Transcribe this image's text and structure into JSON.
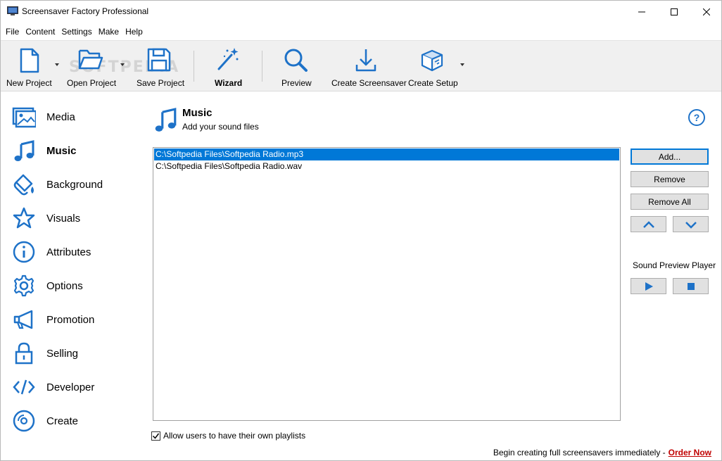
{
  "window": {
    "title": "Screensaver Factory Professional",
    "controls": {
      "minimize": "minimize-icon",
      "maximize": "maximize-icon",
      "close": "close-icon"
    }
  },
  "menu": [
    "File",
    "Content",
    "Settings",
    "Make",
    "Help"
  ],
  "toolbar": {
    "watermark": "SOFTPEDIA",
    "buttons": [
      {
        "label": "New Project",
        "icon": "new-file-icon"
      },
      {
        "label": "Open Project",
        "icon": "open-folder-icon"
      },
      {
        "label": "Save Project",
        "icon": "save-icon"
      },
      {
        "label": "Wizard",
        "icon": "magic-wand-icon"
      },
      {
        "label": "Preview",
        "icon": "magnifier-icon"
      },
      {
        "label": "Create Screensaver",
        "icon": "download-arrow-icon"
      },
      {
        "label": "Create Setup",
        "icon": "package-box-icon"
      }
    ]
  },
  "sidebar": {
    "items": [
      {
        "label": "Media",
        "icon": "image-icon",
        "active": false
      },
      {
        "label": "Music",
        "icon": "music-note-icon",
        "active": true
      },
      {
        "label": "Background",
        "icon": "paint-bucket-icon",
        "active": false
      },
      {
        "label": "Visuals",
        "icon": "star-icon",
        "active": false
      },
      {
        "label": "Attributes",
        "icon": "info-icon",
        "active": false
      },
      {
        "label": "Options",
        "icon": "gear-icon",
        "active": false
      },
      {
        "label": "Promotion",
        "icon": "megaphone-icon",
        "active": false
      },
      {
        "label": "Selling",
        "icon": "lock-icon",
        "active": false
      },
      {
        "label": "Developer",
        "icon": "code-icon",
        "active": false
      },
      {
        "label": "Create",
        "icon": "disc-icon",
        "active": false
      }
    ]
  },
  "content": {
    "title": "Music",
    "subtitle": "Add your sound files",
    "files": [
      {
        "path": "C:\\Softpedia Files\\Softpedia Radio.mp3",
        "selected": true
      },
      {
        "path": "C:\\Softpedia Files\\Softpedia Radio.wav",
        "selected": false
      }
    ],
    "buttons": {
      "add": "Add...",
      "remove": "Remove",
      "remove_all": "Remove All"
    },
    "preview_player_label": "Sound Preview Player",
    "allow_playlists_label": "Allow users to have their own playlists",
    "allow_playlists_checked": true
  },
  "footer": {
    "text": "Begin creating full screensavers immediately -",
    "link": "Order Now"
  },
  "colors": {
    "accent": "#1e72c8",
    "selection": "#0078d7",
    "link": "#c00000"
  }
}
